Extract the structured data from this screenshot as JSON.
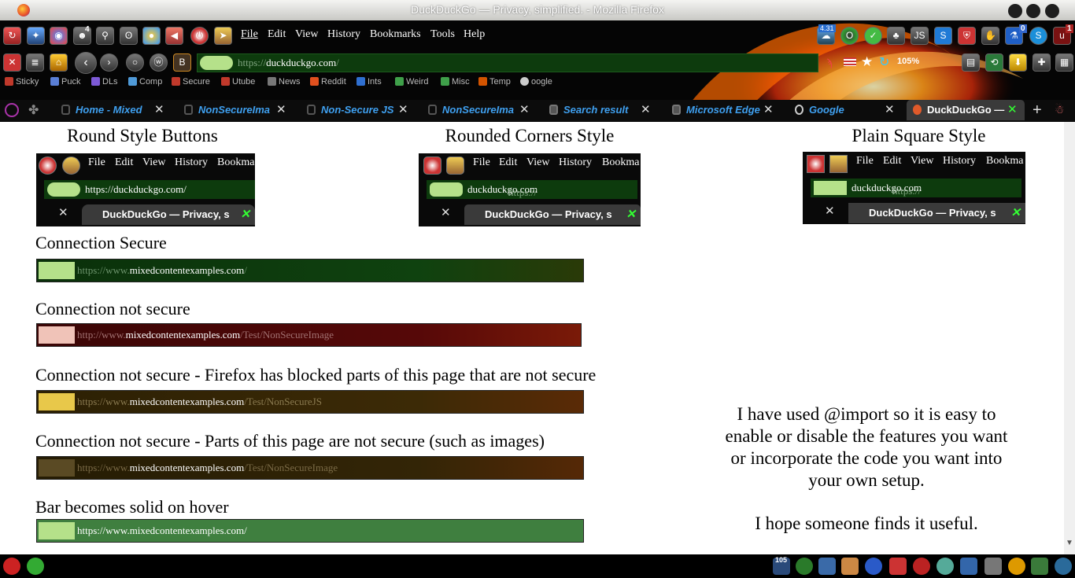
{
  "window": {
    "title": "DuckDuckGo — Privacy, simplified. - Mozilla Firefox"
  },
  "toolbar": {
    "badge_count": "4"
  },
  "menu": {
    "items": [
      "File",
      "Edit",
      "View",
      "History",
      "Bookmarks",
      "Tools",
      "Help"
    ]
  },
  "extensions": {
    "counter": "4.31",
    "js": "JS",
    "badge_a": "0",
    "badge_b": "1"
  },
  "urlbar": {
    "scheme": "https://",
    "host": "duckduckgo.com",
    "path": "/",
    "zoom": "105%"
  },
  "bookmarks": [
    {
      "label": "Sticky",
      "color": "#c0392b"
    },
    {
      "label": "Puck",
      "color": "#5a7fd6"
    },
    {
      "label": "DLs",
      "color": "#7d5ad6"
    },
    {
      "label": "Comp",
      "color": "#4f9ad8"
    },
    {
      "label": "Secure",
      "color": "#c0392b"
    },
    {
      "label": "Utube",
      "color": "#c0392b"
    },
    {
      "label": "News",
      "color": "#777777"
    },
    {
      "label": "Reddit",
      "color": "#e0501e"
    },
    {
      "label": "Ints",
      "color": "#2f6fd0"
    },
    {
      "label": "Weird",
      "color": "#3fa04a"
    },
    {
      "label": "Misc",
      "color": "#3fa04a"
    },
    {
      "label": "Temp",
      "color": "#d35400"
    },
    {
      "label": "oogle",
      "color": "#cccccc"
    }
  ],
  "tabs": [
    {
      "label": "Home - Mixed"
    },
    {
      "label": "NonSecureIma"
    },
    {
      "label": "Non-Secure JS"
    },
    {
      "label": "NonSecureIma"
    },
    {
      "label": "Search result"
    },
    {
      "label": "Microsoft Edge"
    },
    {
      "label": "Google"
    },
    {
      "label": "DuckDuckGo —"
    }
  ],
  "sections": {
    "round": "Round Style Buttons",
    "rounded": "Rounded Corners Style",
    "square": "Plain Square Style"
  },
  "preview": {
    "menu": [
      "File",
      "Edit",
      "View",
      "History",
      "Bookma"
    ],
    "round_url": "https://duckduckgo.com/",
    "scheme": "https://",
    "host": "duckduckgo.com",
    "path": "/",
    "tab_label": "DuckDuckGo — Privacy, s"
  },
  "states": [
    {
      "heading": "Connection Secure",
      "scheme": "https://www.",
      "host": "mixedcontentexamples.com",
      "path": "/"
    },
    {
      "heading": "Connection not secure",
      "scheme": "http://www.",
      "host": "mixedcontentexamples.com",
      "path": "/Test/NonSecureImage"
    },
    {
      "heading": "Connection not secure - Firefox has blocked parts of this page that are not secure",
      "scheme": "https://www.",
      "host": "mixedcontentexamples.com",
      "path": "/Test/NonSecureJS"
    },
    {
      "heading": "Connection not secure - Parts of this page are not secure (such as images)",
      "scheme": "https://www.",
      "host": "mixedcontentexamples.com",
      "path": "/Test/NonSecureImage"
    },
    {
      "heading": "Bar becomes solid on hover",
      "url": "https://www.mixedcontentexamples.com/"
    }
  ],
  "notes": {
    "line1": "I have used @import so it is easy to",
    "line2": "enable or disable the features you want",
    "line3": "or incorporate the code you want into",
    "line4": "your own setup.",
    "line5": "I hope someone finds it useful."
  },
  "taskbar": {
    "badge": "105"
  },
  "colors": {
    "accent_green": "#33ff33",
    "secure_bar": "#0d3b0d",
    "insecure_bar": "#4a0808",
    "blocked_bar": "#3a2a04",
    "hover_bar": "#3f7f3f"
  }
}
